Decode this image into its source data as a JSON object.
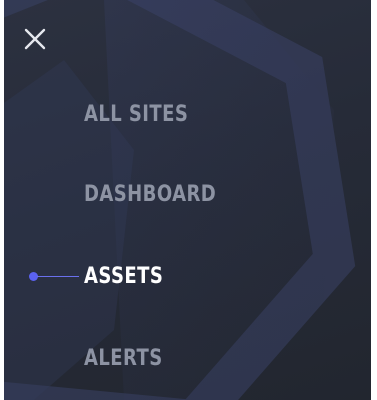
{
  "menu": {
    "close_icon": "close-icon",
    "items": [
      {
        "label": "ALL SITES",
        "active": false
      },
      {
        "label": "DASHBOARD",
        "active": false
      },
      {
        "label": "ASSETS",
        "active": true
      },
      {
        "label": "ALERTS",
        "active": false
      }
    ]
  },
  "colors": {
    "background": "#272b37",
    "accent": "#5b62f0",
    "inactive_text": "#8d93a3",
    "active_text": "#ffffff"
  }
}
